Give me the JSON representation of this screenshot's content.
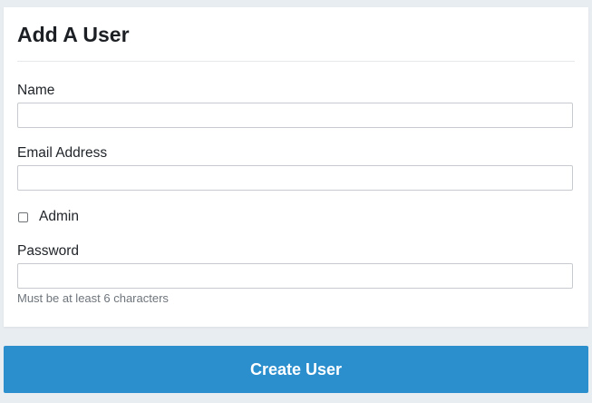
{
  "form": {
    "title": "Add A User",
    "name": {
      "label": "Name",
      "value": "",
      "placeholder": ""
    },
    "email": {
      "label": "Email Address",
      "value": "",
      "placeholder": ""
    },
    "admin": {
      "label": "Admin",
      "checked": false
    },
    "password": {
      "label": "Password",
      "value": "",
      "placeholder": "",
      "help": "Must be at least 6 characters"
    }
  },
  "submit": {
    "label": "Create User"
  },
  "colors": {
    "page_background": "#e8edf1",
    "card_background": "#ffffff",
    "primary_button": "#2c8fcd",
    "input_border": "#c7cbcf",
    "help_text": "#6e757c"
  }
}
